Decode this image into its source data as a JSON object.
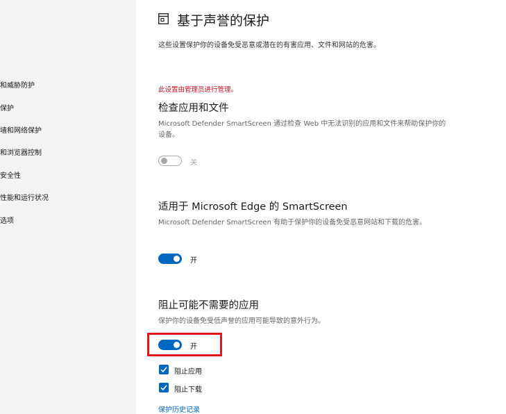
{
  "sidebar": {
    "items": [
      {
        "label": "和威胁防护"
      },
      {
        "label": "保护"
      },
      {
        "label": "墙和网络保护"
      },
      {
        "label": "和浏览器控制"
      },
      {
        "label": "安全性"
      },
      {
        "label": "性能和运行状况"
      },
      {
        "label": "选项"
      }
    ]
  },
  "header": {
    "icon": "app-browser-icon",
    "title": "基于声誉的保护",
    "description": "这些设置保护你的设备免受恶意或潜在的有害应用、文件和网站的危害。"
  },
  "managed_notice": "此设置由管理员进行管理。",
  "sections": [
    {
      "title": "检查应用和文件",
      "description": "Microsoft Defender SmartScreen 通过检查 Web 中无法识别的应用和文件来帮助保护你的设备。",
      "toggle_state": false,
      "toggle_label": "关"
    },
    {
      "title": "适用于 Microsoft Edge 的 SmartScreen",
      "description": "Microsoft Defender SmartScreen 有助于保护你的设备免受恶意网站和下载的危害。",
      "toggle_state": true,
      "toggle_label": "开"
    },
    {
      "title": "阻止可能不需要的应用",
      "description": "保护你的设备免受低声誉的应用可能导致的意外行为。",
      "toggle_state": true,
      "toggle_label": "开"
    }
  ],
  "checkboxes": [
    {
      "label": "阻止应用",
      "checked": true
    },
    {
      "label": "阻止下载",
      "checked": true
    }
  ],
  "history_link": "保护历史记录",
  "colors": {
    "accent": "#0067c0",
    "warning": "#c50f1f",
    "highlight": "#e0181e"
  }
}
